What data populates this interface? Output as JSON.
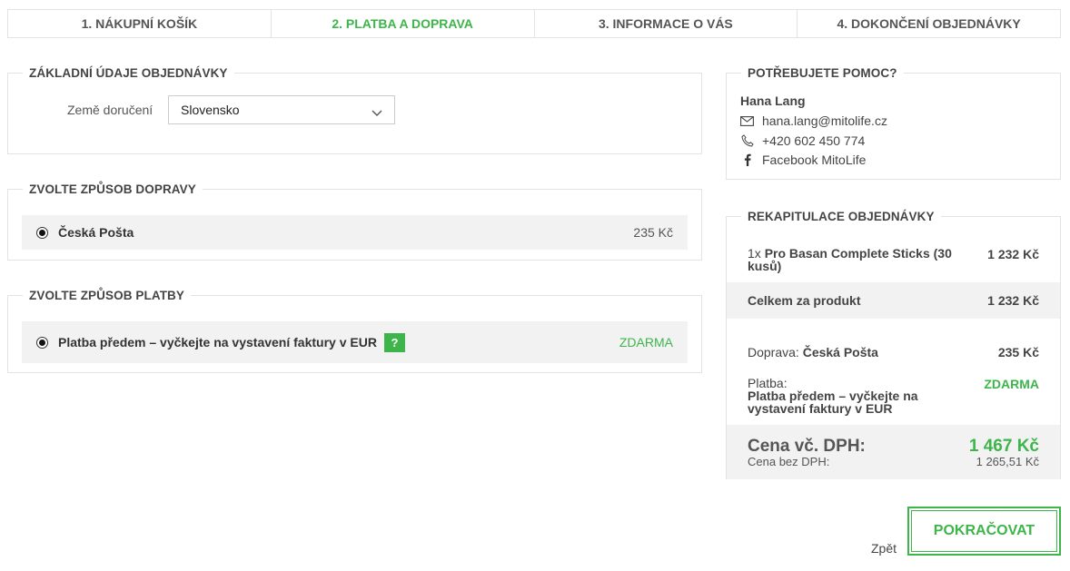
{
  "steps": [
    {
      "label": "1. NÁKUPNÍ KOŠÍK",
      "active": false
    },
    {
      "label": "2. PLATBA A DOPRAVA",
      "active": true
    },
    {
      "label": "3. INFORMACE O VÁS",
      "active": false
    },
    {
      "label": "4. DOKONČENÍ OBJEDNÁVKY",
      "active": false
    }
  ],
  "basic": {
    "title": "ZÁKLADNÍ ÚDAJE OBJEDNÁVKY",
    "country_label": "Země doručení",
    "country_value": "Slovensko"
  },
  "shipping": {
    "title": "ZVOLTE ZPŮSOB DOPRAVY",
    "option_label": "Česká Pošta",
    "option_price": "235 Kč"
  },
  "payment": {
    "title": "ZVOLTE ZPŮSOB PLATBY",
    "option_label": "Platba předem – vyčkejte na vystavení faktury v EUR",
    "help_label": "?",
    "option_price": "ZDARMA"
  },
  "help": {
    "title": "POTŘEBUJETE POMOC?",
    "name": "Hana Lang",
    "email": "hana.lang@mitolife.cz",
    "phone": "+420 602 450 774",
    "facebook": "Facebook MitoLife"
  },
  "summary": {
    "title": "REKAPITULACE OBJEDNÁVKY",
    "item_qty": "1x",
    "item_name": "Pro Basan Complete Sticks (30 kusů)",
    "item_price": "1 232 Kč",
    "subtotal_label": "Celkem za produkt",
    "subtotal_value": "1 232 Kč",
    "shipping_label": "Doprava:",
    "shipping_name": "Česká Pošta",
    "shipping_price": "235 Kč",
    "payment_label": "Platba:",
    "payment_name": "Platba předem – vyčkejte na vystavení faktury v EUR",
    "payment_price": "ZDARMA",
    "total_label": "Cena vč. DPH:",
    "total_value": "1 467 Kč",
    "net_label": "Cena bez DPH:",
    "net_value": "1 265,51 Kč"
  },
  "actions": {
    "back_label": "Zpět",
    "continue_label": "POKRAČOVAT"
  },
  "colors": {
    "accent": "#3db54a",
    "panel_gray": "#f2f2f2"
  }
}
